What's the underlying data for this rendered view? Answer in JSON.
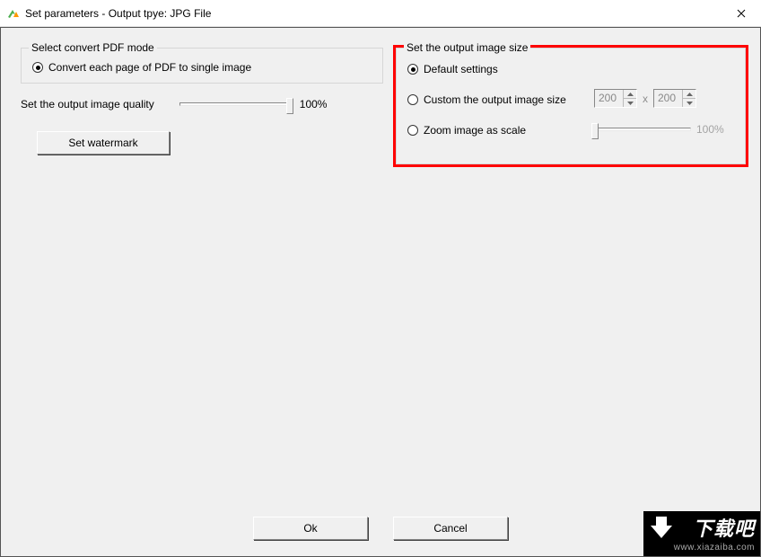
{
  "window": {
    "title": "Set parameters - Output tpye: JPG File",
    "close_icon": "close"
  },
  "left_group": {
    "legend": "Select convert PDF mode",
    "option1": "Convert each page of PDF to single image",
    "selected": "option1"
  },
  "quality": {
    "label": "Set the output image quality",
    "percent": "100%",
    "value": 100
  },
  "watermark_button": "Set watermark",
  "right_group": {
    "legend": "Set the output image size",
    "option_default": "Default settings",
    "option_custom": "Custom the output image size",
    "option_zoom": "Zoom image as scale",
    "selected": "default",
    "custom_width": "200",
    "custom_height": "200",
    "size_sep": "x",
    "zoom_percent": "100%"
  },
  "footer": {
    "ok": "Ok",
    "cancel": "Cancel"
  },
  "watermark_badge": {
    "text": "下载吧",
    "url": "www.xiazaiba.com"
  }
}
